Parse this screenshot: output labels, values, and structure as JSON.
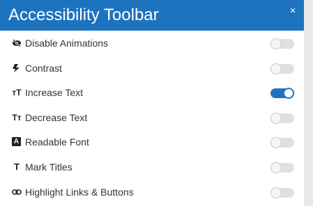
{
  "header": {
    "title": "Accessibility Toolbar",
    "close_label": "×"
  },
  "items": [
    {
      "label": "Disable Animations",
      "icon": "eye-slash-icon",
      "enabled": false
    },
    {
      "label": "Contrast",
      "icon": "contrast-icon",
      "enabled": false
    },
    {
      "label": "Increase Text",
      "icon": "increase-text-icon",
      "icon_text": "тT",
      "enabled": true
    },
    {
      "label": "Decrease Text",
      "icon": "decrease-text-icon",
      "icon_text": "Tт",
      "enabled": false
    },
    {
      "label": "Readable Font",
      "icon": "readable-font-icon",
      "icon_text": "A",
      "enabled": false
    },
    {
      "label": "Mark Titles",
      "icon": "mark-titles-icon",
      "icon_text": "T",
      "enabled": false
    },
    {
      "label": "Highlight Links & Buttons",
      "icon": "link-icon",
      "enabled": false
    }
  ],
  "colors": {
    "accent": "#1e73be",
    "toggle_off": "#e0e0e0",
    "text": "#333333"
  }
}
